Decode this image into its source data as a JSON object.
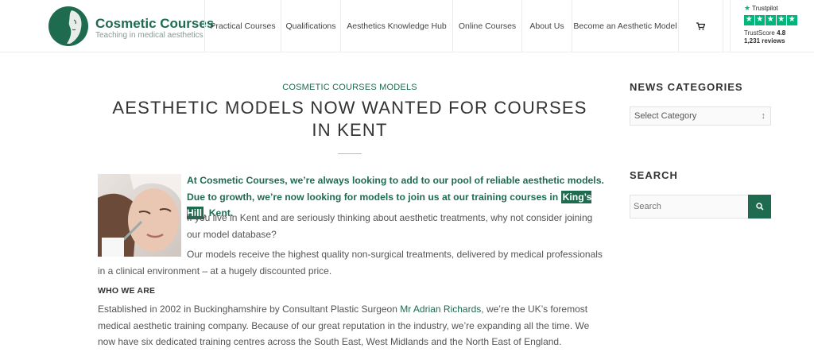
{
  "header": {
    "logo": {
      "title": "Cosmetic Courses",
      "tagline": "Teaching in medical aesthetics"
    },
    "nav": [
      {
        "label": "Practical Courses"
      },
      {
        "label": "Qualifications"
      },
      {
        "label": "Aesthetics Knowledge Hub"
      },
      {
        "label": "Online Courses"
      },
      {
        "label": "About Us"
      },
      {
        "label": "Become an Aesthetic Model"
      }
    ],
    "cart_icon": "shopping-cart-icon",
    "trustpilot": {
      "brand": "Trustpilot",
      "score_label": "TrustScore",
      "score": "4.8",
      "reviews": "1,231 reviews",
      "stars": 5
    }
  },
  "article": {
    "category": "COSMETIC COURSES MODELS",
    "title": "AESTHETIC MODELS NOW WANTED FOR COURSES IN KENT",
    "lead_before": "At Cosmetic Courses, we’re always looking to add to our pool of reliable aesthetic models. Due to growth, we’re now looking for models to join us at our training courses in",
    "lead_highlight": "King’s Hill",
    "lead_after": ", Kent.",
    "p1": "If you live in Kent and are seriously thinking about aesthetic treatments, why not consider joining our model database?",
    "p2": "Our models receive the highest quality non-surgical treatments, delivered by medical professionals in a clinical environment – at a hugely discounted price.",
    "who_heading": "WHO WE ARE",
    "p3_before": "Established in 2002 in Buckinghamshire by Consultant Plastic Surgeon",
    "p3_link": "Mr Adrian Richards",
    "p3_after": ", we’re the UK’s foremost medical aesthetic training company. Because of our great reputation in the industry, we’re expanding all the time. We now have six dedicated training centres across the South East, West Midlands and the North East of England."
  },
  "sidebar": {
    "categories_heading": "NEWS CATEGORIES",
    "category_select": "Select Category",
    "search_heading": "SEARCH",
    "search_placeholder": "Search"
  },
  "colors": {
    "brand_green": "#1e6b4f",
    "trustpilot_green": "#00b67a"
  }
}
